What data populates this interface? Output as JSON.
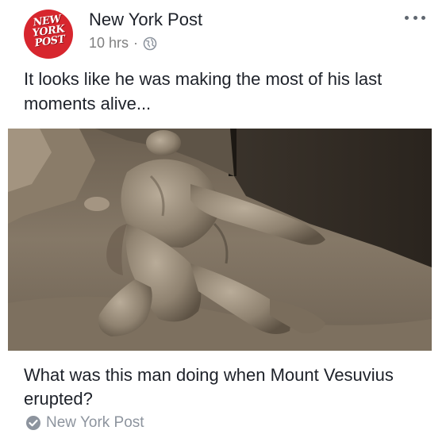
{
  "post": {
    "page_name": "New York Post",
    "time": "10 hrs",
    "separator": "·",
    "avatar_logo_lines": [
      "NEW",
      "YORK",
      "POST"
    ],
    "caption": "It looks like he was making the most of his last moments alive...",
    "more_icon": "ellipsis-icon",
    "audience_icon": "globe-icon"
  },
  "link": {
    "title": "What was this man doing when Mount Vesuvius erupted?",
    "source": "New York Post",
    "source_icon": "verified-check-icon"
  },
  "colors": {
    "avatar_red": "#d7262e",
    "text": "#1d2129",
    "meta_gray": "#7f7f7f",
    "source_gray": "#8d949e"
  }
}
